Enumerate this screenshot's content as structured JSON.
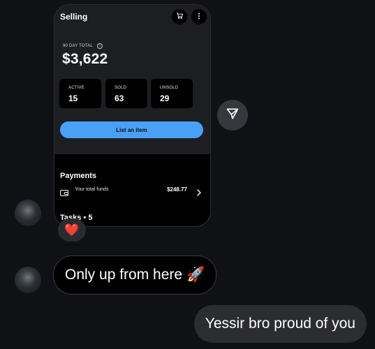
{
  "screenshot": {
    "title": "Selling",
    "summary_label": "90 DAY TOTAL",
    "summary_value": "$3,622",
    "stats": [
      {
        "label": "ACTIVE",
        "value": "15"
      },
      {
        "label": "SOLD",
        "value": "63"
      },
      {
        "label": "UNSOLD",
        "value": "29"
      }
    ],
    "primary_action": "List an item",
    "payments_heading": "Payments",
    "funds_label": "Your total funds",
    "funds_amount": "$248.77",
    "tasks_heading": "Tasks • 5",
    "icons": [
      "cart-icon",
      "more-icon",
      "info-icon",
      "wallet-icon",
      "chevron-right-icon"
    ]
  },
  "share_icon": "paper-plane-icon",
  "reaction": "❤️",
  "messages": [
    {
      "side": "incoming",
      "text": "Only up from here",
      "emoji": "🚀"
    },
    {
      "side": "outgoing",
      "text": "Yessir bro proud of you"
    }
  ],
  "colors": {
    "background": "#0f1115",
    "accent_button": "#4aa0f7",
    "incoming_bubble": "#000000",
    "outgoing_bubble": "#2c2d31",
    "reaction": "#f0263b"
  }
}
